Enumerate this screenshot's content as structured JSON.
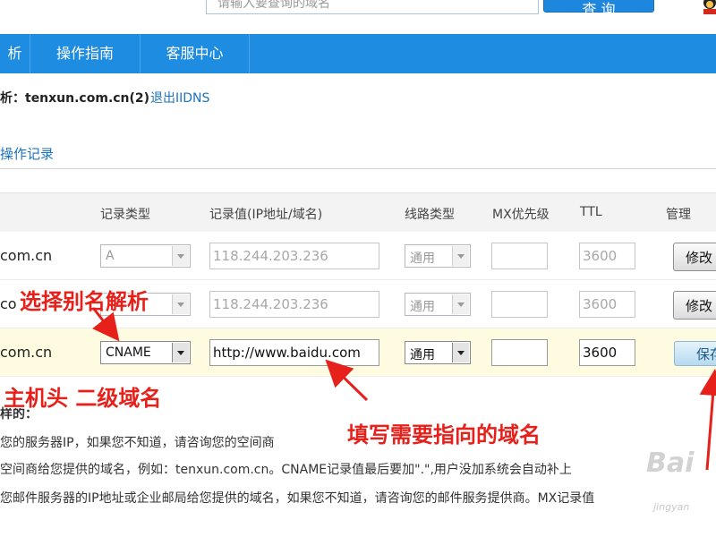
{
  "search": {
    "placeholder": "请输入要查询的域名",
    "button_label": "查 询"
  },
  "nav": {
    "items": [
      "析",
      "操作指南",
      "客服中心"
    ]
  },
  "breadcrumb": {
    "text": "析：tenxun.com.cn(2)",
    "logout": "退出IIDNS"
  },
  "op_record_link": "操作记录",
  "table": {
    "headers": [
      "记录类型",
      "记录值(IP地址/域名)",
      "线路类型",
      "MX优先级",
      "TTL",
      "管理"
    ],
    "rows": [
      {
        "host": "com.cn",
        "type": "A",
        "value": "118.244.203.236",
        "line": "通用",
        "mx": "",
        "ttl": "3600",
        "action": "修改"
      },
      {
        "host": "co",
        "type": "A",
        "value": "118.244.203.236",
        "line": "通用",
        "mx": "",
        "ttl": "3600",
        "action": "修改"
      },
      {
        "host": "com.cn",
        "type": "CNAME",
        "value": "http://www.baidu.com",
        "line": "通用",
        "mx": "",
        "ttl": "3600",
        "action": "保存"
      }
    ]
  },
  "help": {
    "title": "样的：",
    "lines": [
      "您的服务器IP，如果您不知道，请咨询您的空间商",
      "空间商给您提供的域名，例如：tenxun.com.cn。CNAME记录值最后要加\".\",用户没加系统会自动补上",
      "您邮件服务器的IP地址或企业邮局给您提供的域名，如果您不知道，请咨询您的邮件服务提供商。MX记录值"
    ]
  },
  "annotations": {
    "select_alias": "选择别名解析",
    "host_label": "主机头 二级域名",
    "fill_domain": "填写需要指向的域名"
  },
  "watermark": {
    "logo": "Bai",
    "sub": "jingyan"
  },
  "colors": {
    "nav_bg": "#1e8ce0",
    "link": "#1e73be",
    "annotation": "#e6201a",
    "highlight_row": "#fffbe0"
  }
}
